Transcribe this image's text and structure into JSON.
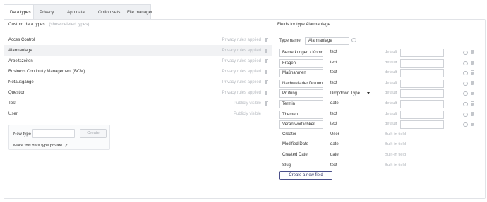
{
  "tabs": [
    {
      "label": "Data types",
      "active": true
    },
    {
      "label": "Privacy",
      "active": false
    },
    {
      "label": "App data",
      "active": false
    },
    {
      "label": "Option sets",
      "active": false
    },
    {
      "label": "File manager",
      "active": false
    }
  ],
  "left": {
    "heading": "Custom data types",
    "show_deleted": "(show deleted types)",
    "types": [
      {
        "name": "Acces Control",
        "privacy": "Privacy rules applied",
        "trash": true,
        "selected": false
      },
      {
        "name": "Alarmanlage",
        "privacy": "Privacy rules applied",
        "trash": true,
        "selected": true
      },
      {
        "name": "Arbeitszeiten",
        "privacy": "Privacy rules applied",
        "trash": true,
        "selected": false
      },
      {
        "name": "Business Continuity Management (BCM)",
        "privacy": "Privacy rules applied",
        "trash": true,
        "selected": false
      },
      {
        "name": "Notausgänge",
        "privacy": "Privacy rules applied",
        "trash": true,
        "selected": false
      },
      {
        "name": "Question",
        "privacy": "Privacy rules applied",
        "trash": true,
        "selected": false
      },
      {
        "name": "Test",
        "privacy": "Publicly visible",
        "trash": true,
        "selected": false
      },
      {
        "name": "User",
        "privacy": "Publicly visible",
        "trash": false,
        "selected": false
      }
    ],
    "new_type": {
      "label": "New type",
      "value": "",
      "create_label": "Create",
      "private_label": "Make this data type private",
      "private_mark": "✓"
    }
  },
  "right": {
    "heading": "Fields for type Alarmanlage",
    "type_name_label": "Type name",
    "type_name_value": "Alarmanlage",
    "fields": [
      {
        "name": "Bemerkungen / Kommentare",
        "type": "text",
        "default_label": "default",
        "editable": true
      },
      {
        "name": "Fragen",
        "type": "text",
        "default_label": "default",
        "editable": true
      },
      {
        "name": "Maßnahmen",
        "type": "text",
        "default_label": "default",
        "editable": true
      },
      {
        "name": "Nachweis der Dokumentation",
        "type": "text",
        "default_label": "default",
        "editable": true
      },
      {
        "name": "Prüfung",
        "type": "Dropdown Type",
        "default_label": "default",
        "editable": true,
        "select": true
      },
      {
        "name": "Termin",
        "type": "date",
        "default_label": "default",
        "editable": true
      },
      {
        "name": "Themen",
        "type": "text",
        "default_label": "default",
        "editable": true
      },
      {
        "name": "Verantwortlichkeit",
        "type": "text",
        "default_label": "default",
        "editable": true
      },
      {
        "name": "Creator",
        "type": "User",
        "builtin": "Built-in field",
        "editable": false
      },
      {
        "name": "Modified Date",
        "type": "date",
        "builtin": "Built-in field",
        "editable": false
      },
      {
        "name": "Created Date",
        "type": "date",
        "builtin": "Built-in field",
        "editable": false
      },
      {
        "name": "Slug",
        "type": "text",
        "builtin": "Built-in field",
        "editable": false
      }
    ],
    "create_field_label": "Create a new field"
  },
  "icons": {
    "trash": "trash-icon",
    "comment": "comment-bubble-icon",
    "caret": "caret-down-icon"
  }
}
